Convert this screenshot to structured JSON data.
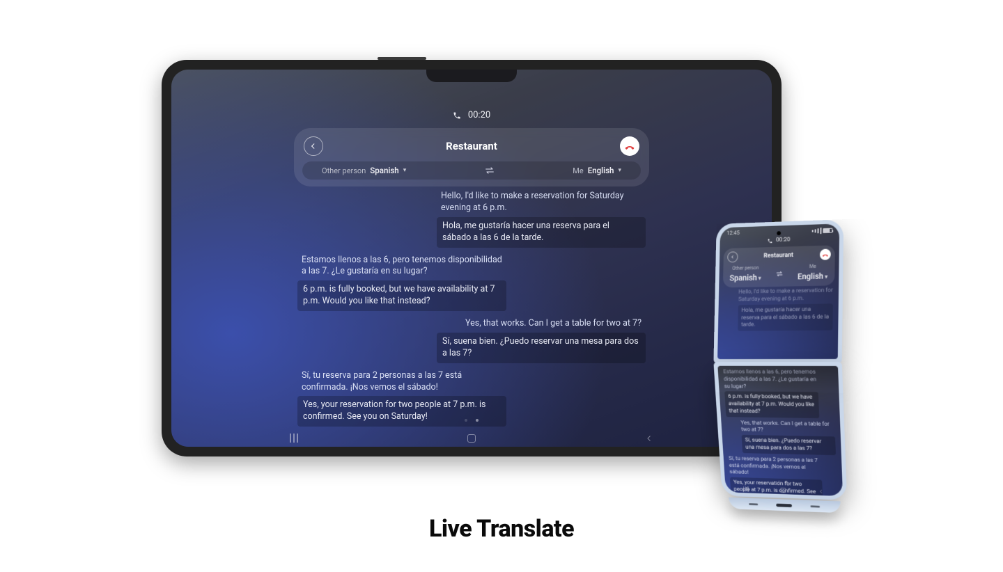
{
  "caption": "Live Translate",
  "call": {
    "duration": "00:20",
    "title": "Restaurant",
    "other_label": "Other person",
    "me_label": "Me",
    "other_language": "Spanish",
    "me_language": "English"
  },
  "messages": [
    {
      "side": "me",
      "original": "Hello, I'd like to make a reservation for Saturday evening at 6 p.m.",
      "translated": "Hola, me gustaría hacer una reserva para el sábado a las 6 de la tarde."
    },
    {
      "side": "them",
      "original": "Estamos llenos a las 6, pero tenemos disponibilidad a las 7. ¿Le gustaría en su lugar?",
      "translated": "6 p.m. is fully booked, but we have availability at 7 p.m. Would you like that instead?"
    },
    {
      "side": "me",
      "original": "Yes, that works. Can I get a table for two at 7?",
      "translated": "Sí, suena bien. ¿Puedo reservar una mesa para dos a las 7?"
    },
    {
      "side": "them",
      "original": "Sí, tu reserva para 2 personas a las 7 está confirmada. ¡Nos vemos el sábado!",
      "translated": "Yes, your reservation for two people at 7 p.m. is confirmed. See you on Saturday!"
    }
  ],
  "phone": {
    "clock": "12:45"
  },
  "colors": {
    "hangup": "#e03b3b"
  }
}
